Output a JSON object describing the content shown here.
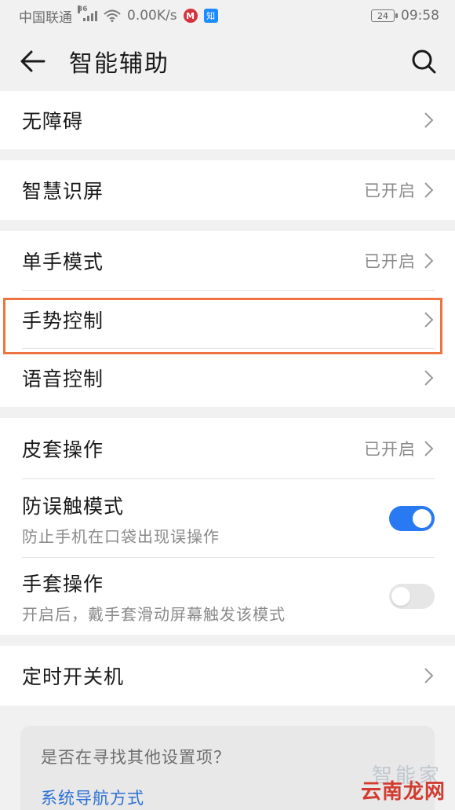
{
  "status_bar": {
    "carrier": "中国联通",
    "network": "36",
    "speed": "0.00K/s",
    "app_icon": "M",
    "zhi_icon": "知",
    "battery": "24",
    "time": "09:58"
  },
  "header": {
    "title": "智能辅助",
    "back_icon": "arrow-left-icon",
    "search_icon": "search-icon"
  },
  "sections": {
    "accessibility": {
      "label": "无障碍"
    },
    "smart_screen": {
      "label": "智慧识屏",
      "status": "已开启"
    },
    "one_hand": {
      "label": "单手模式",
      "status": "已开启"
    },
    "gesture": {
      "label": "手势控制"
    },
    "voice": {
      "label": "语音控制"
    },
    "cover": {
      "label": "皮套操作",
      "status": "已开启"
    },
    "accidental_touch": {
      "label": "防误触模式",
      "desc": "防止手机在口袋出现误操作",
      "enabled": true
    },
    "glove": {
      "label": "手套操作",
      "desc": "开启后，戴手套滑动屏幕触发该模式",
      "enabled": false
    },
    "scheduled_power": {
      "label": "定时开关机"
    }
  },
  "suggest": {
    "question": "是否在寻找其他设置项？",
    "link": "系统导航方式"
  },
  "watermark": {
    "top": "智能家",
    "bottom": "云南龙网"
  },
  "colors": {
    "accent": "#2979f2",
    "highlight": "#ee7340",
    "link": "#2a6fd6"
  }
}
